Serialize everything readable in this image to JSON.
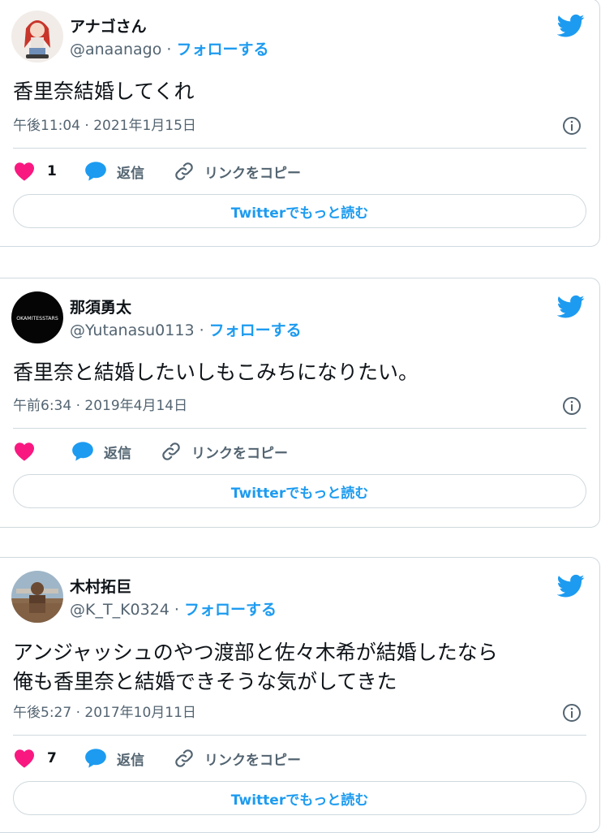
{
  "tweets": [
    {
      "name": "アナゴさん",
      "handle": "@anaanago",
      "sep": " · ",
      "follow": "フォローする",
      "text": "香里奈結婚してくれ",
      "meta": "午後11:04 · 2021年1月15日",
      "likes": "1",
      "reply": "返信",
      "copy": "リンクをコピー",
      "more": "Twitterでもっと読む"
    },
    {
      "name": "那須勇太",
      "handle": "@Yutanasu0113",
      "sep": " · ",
      "follow": "フォローする",
      "text": "香里奈と結婚したいしもこみちになりたい。",
      "meta": "午前6:34 · 2019年4月14日",
      "likes": "",
      "reply": "返信",
      "copy": "リンクをコピー",
      "more": "Twitterでもっと読む",
      "avatar_text": "OKAMITESSTARS"
    },
    {
      "name": "木村拓巨",
      "handle": "@K_T_K0324",
      "sep": " · ",
      "follow": "フォローする",
      "text_line1": "アンジャッシュのやつ渡部と佐々木希が結婚したなら",
      "text_line2": "俺も香里奈と結婚できそうな気がしてきた",
      "meta": "午後5:27 · 2017年10月11日",
      "likes": "7",
      "reply": "返信",
      "copy": "リンクをコピー",
      "more": "Twitterでもっと読む"
    }
  ],
  "colors": {
    "accent": "#1d9bf0",
    "like": "#f91880",
    "muted": "#536471",
    "border": "#cfd9de"
  },
  "icons": [
    "twitter-bird-icon",
    "info-icon",
    "heart-icon",
    "reply-icon",
    "link-icon"
  ]
}
